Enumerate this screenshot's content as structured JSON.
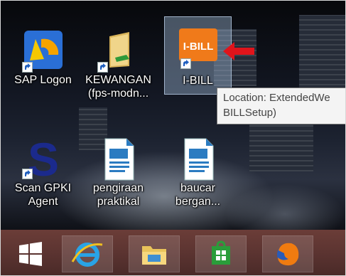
{
  "desktop": {
    "icons": [
      {
        "id": "sap-logon",
        "label_lines": [
          "SAP Logon"
        ],
        "icon": "sap-logon-icon",
        "selected": false
      },
      {
        "id": "kewangan",
        "label_lines": [
          "KEWANGAN",
          "(fps-modn..."
        ],
        "icon": "folder-icon",
        "selected": false
      },
      {
        "id": "ibill",
        "label_lines": [
          "I-BILL"
        ],
        "icon": "ibill-icon",
        "icon_text": "I-BILL",
        "selected": true
      },
      {
        "id": "scan-gpki",
        "label_lines": [
          "Scan GPKI",
          "Agent"
        ],
        "icon": "gpki-s-icon",
        "icon_text": "S",
        "selected": false
      },
      {
        "id": "pengiraan",
        "label_lines": [
          "pengiraan",
          "praktikal"
        ],
        "icon": "writer-document-icon",
        "selected": false
      },
      {
        "id": "baucar",
        "label_lines": [
          "baucar",
          "bergan..."
        ],
        "icon": "writer-document-icon",
        "selected": false
      }
    ]
  },
  "tooltip": {
    "lines": [
      "Location: ExtendedWe",
      "BILLSetup)"
    ]
  },
  "annotation": {
    "icon": "red-arrow-icon",
    "color": "#e0141b"
  },
  "taskbar": {
    "items": [
      {
        "icon": "windows-start-icon"
      },
      {
        "icon": "internet-explorer-icon"
      },
      {
        "icon": "file-explorer-icon"
      },
      {
        "icon": "windows-store-icon"
      },
      {
        "icon": "firefox-icon"
      }
    ]
  },
  "colors": {
    "ibill_orange": "#f07a1a",
    "taskbar": "#5a3330",
    "selection": "#9fb8d6"
  }
}
